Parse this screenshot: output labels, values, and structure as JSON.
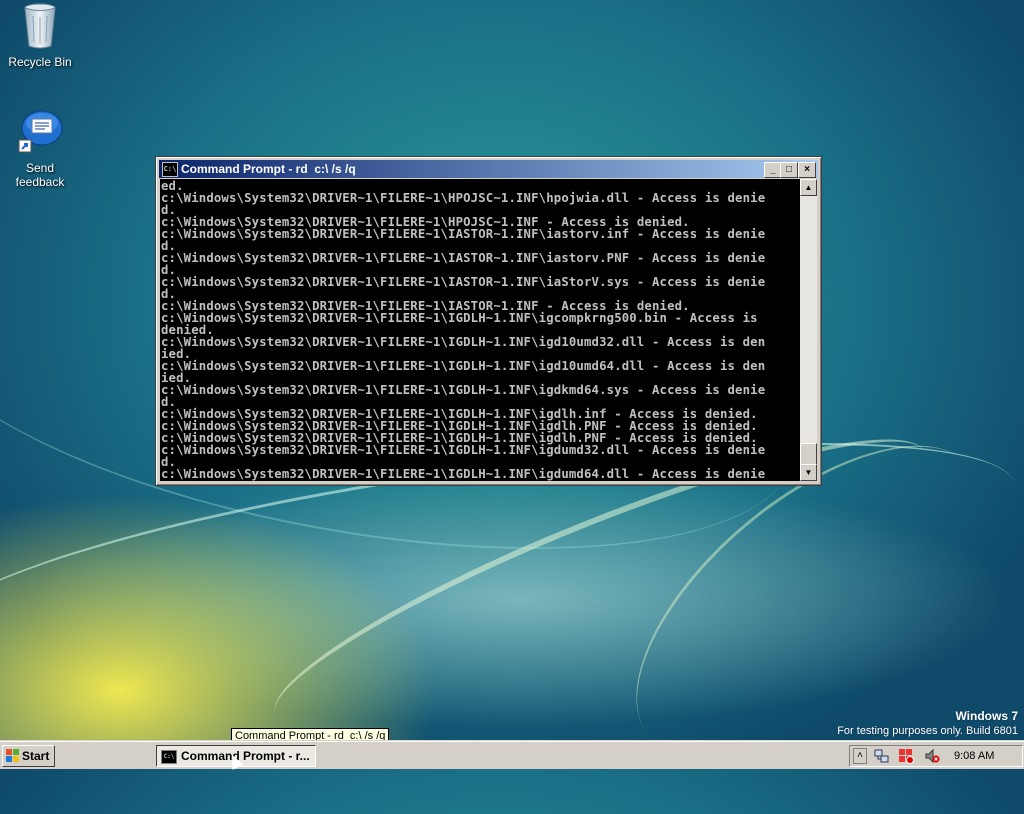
{
  "desktop": {
    "icons": [
      {
        "label": "Recycle Bin",
        "icon": "recycle-bin-icon"
      },
      {
        "label": "Send feedback",
        "icon": "feedback-icon"
      }
    ],
    "watermark_line1": "Windows 7",
    "watermark_line2": "For testing purposes only. Build 6801"
  },
  "window": {
    "title": "Command Prompt - rd  c:\\ /s /q",
    "buttons": {
      "minimize": "_",
      "maximize": "□",
      "close": "×"
    },
    "console_lines": [
      "ed.",
      "c:\\Windows\\System32\\DRIVER~1\\FILERE~1\\HPOJSC~1.INF\\hpojwia.dll - Access is denie",
      "d.",
      "c:\\Windows\\System32\\DRIVER~1\\FILERE~1\\HPOJSC~1.INF - Access is denied.",
      "c:\\Windows\\System32\\DRIVER~1\\FILERE~1\\IASTOR~1.INF\\iastorv.inf - Access is denie",
      "d.",
      "c:\\Windows\\System32\\DRIVER~1\\FILERE~1\\IASTOR~1.INF\\iastorv.PNF - Access is denie",
      "d.",
      "c:\\Windows\\System32\\DRIVER~1\\FILERE~1\\IASTOR~1.INF\\iaStorV.sys - Access is denie",
      "d.",
      "c:\\Windows\\System32\\DRIVER~1\\FILERE~1\\IASTOR~1.INF - Access is denied.",
      "c:\\Windows\\System32\\DRIVER~1\\FILERE~1\\IGDLH~1.INF\\igcompkrng500.bin - Access is",
      "denied.",
      "c:\\Windows\\System32\\DRIVER~1\\FILERE~1\\IGDLH~1.INF\\igd10umd32.dll - Access is den",
      "ied.",
      "c:\\Windows\\System32\\DRIVER~1\\FILERE~1\\IGDLH~1.INF\\igd10umd64.dll - Access is den",
      "ied.",
      "c:\\Windows\\System32\\DRIVER~1\\FILERE~1\\IGDLH~1.INF\\igdkmd64.sys - Access is denie",
      "d.",
      "c:\\Windows\\System32\\DRIVER~1\\FILERE~1\\IGDLH~1.INF\\igdlh.inf - Access is denied.",
      "c:\\Windows\\System32\\DRIVER~1\\FILERE~1\\IGDLH~1.INF\\igdlh.PNF - Access is denied.",
      "c:\\Windows\\System32\\DRIVER~1\\FILERE~1\\IGDLH~1.INF\\igdlh.PNF - Access is denied.",
      "c:\\Windows\\System32\\DRIVER~1\\FILERE~1\\IGDLH~1.INF\\igdumd32.dll - Access is denie",
      "d.",
      "c:\\Windows\\System32\\DRIVER~1\\FILERE~1\\IGDLH~1.INF\\igdumd64.dll - Access is denie"
    ]
  },
  "tooltip": "Command Prompt - rd  c:\\ /s /q",
  "taskbar": {
    "start_label": "Start",
    "task_label": "Command Prompt - r...",
    "tray_icons": [
      "show-hidden-icons",
      "network-icon",
      "security-center-icon",
      "volume-muted-icon"
    ],
    "clock": "9:08 AM"
  }
}
